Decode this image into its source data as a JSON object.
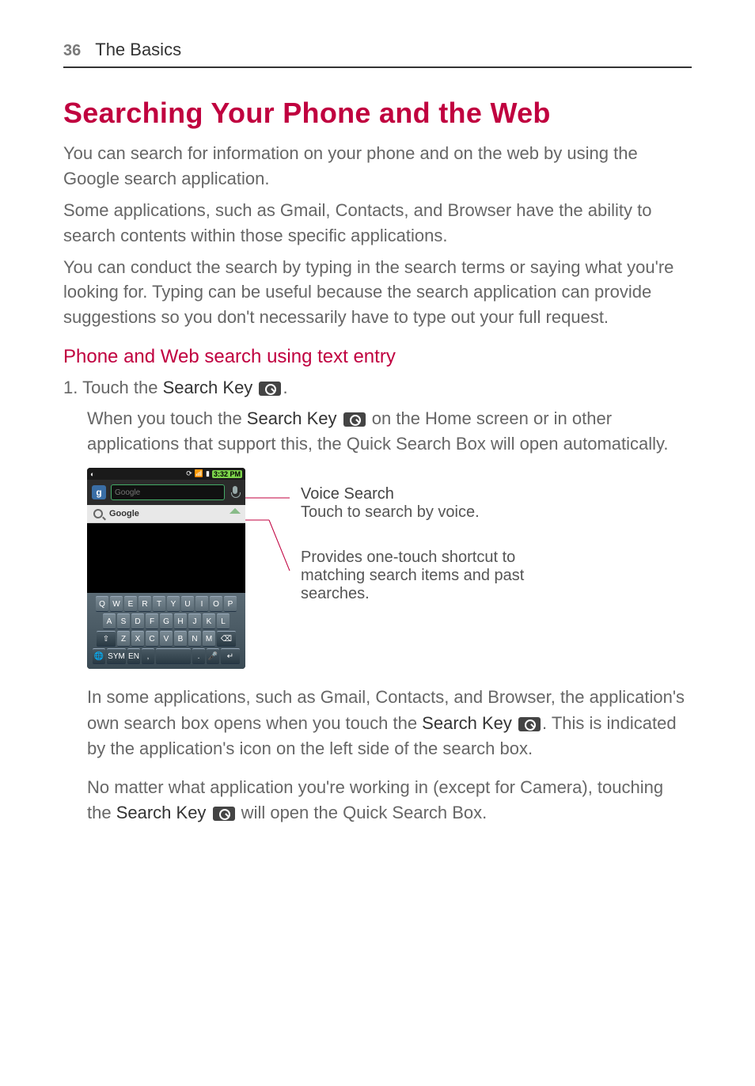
{
  "header": {
    "page_number": "36",
    "section": "The Basics"
  },
  "title": "Searching Your Phone and the Web",
  "intro": {
    "p1": "You can search for information on your phone and on the web by using the Google search application.",
    "p2": "Some applications, such as Gmail, Contacts, and Browser have the ability to search contents within those specific applications.",
    "p3": "You can conduct the search by typing in the search terms or saying what you're looking for. Typing can be useful because the search application can provide suggestions so you don't necessarily have to type out your full request."
  },
  "subhead": "Phone and Web search using text entry",
  "step1": {
    "prefix": "1.  Touch the ",
    "bold": "Search Key",
    "suffix": " ",
    "end": "."
  },
  "step1_detail": {
    "t1": "When you touch the ",
    "b1": "Search Key",
    "t2": " on the Home screen or in other applications that support this, the Quick Search Box will open automatically."
  },
  "phone": {
    "time": "3:32 PM",
    "placeholder": "Google",
    "suggestion": "Google",
    "keys_r1": [
      "Q",
      "W",
      "E",
      "R",
      "T",
      "Y",
      "U",
      "I",
      "O",
      "P"
    ],
    "keys_r2": [
      "A",
      "S",
      "D",
      "F",
      "G",
      "H",
      "J",
      "K",
      "L"
    ],
    "keys_r3_shift": "⇧",
    "keys_r3": [
      "Z",
      "X",
      "C",
      "V",
      "B",
      "N",
      "M"
    ],
    "keys_r3_del": "⌫",
    "keys_r4": {
      "globe": "🌐",
      "sym": "SYM",
      "lang": "EN",
      "comma": ",",
      "space": " ",
      "period": ".",
      "mic": "🎤",
      "enter": "↵"
    }
  },
  "annos": {
    "voice_title": "Voice Search",
    "voice_sub": "Touch to search by voice.",
    "shortcut": "Provides one-touch shortcut to matching search items and past searches."
  },
  "after": {
    "p1a": "In some applications, such as Gmail, Contacts, and Browser, the application's own search box opens when you touch the ",
    "p1b": "Search Key",
    "p1c": ". This is indicated by the application's icon on the left side of the search box.",
    "p2a": "No matter what application you're working in (except for Camera), touching the ",
    "p2b": "Search Key",
    "p2c": " will open the Quick Search Box."
  }
}
